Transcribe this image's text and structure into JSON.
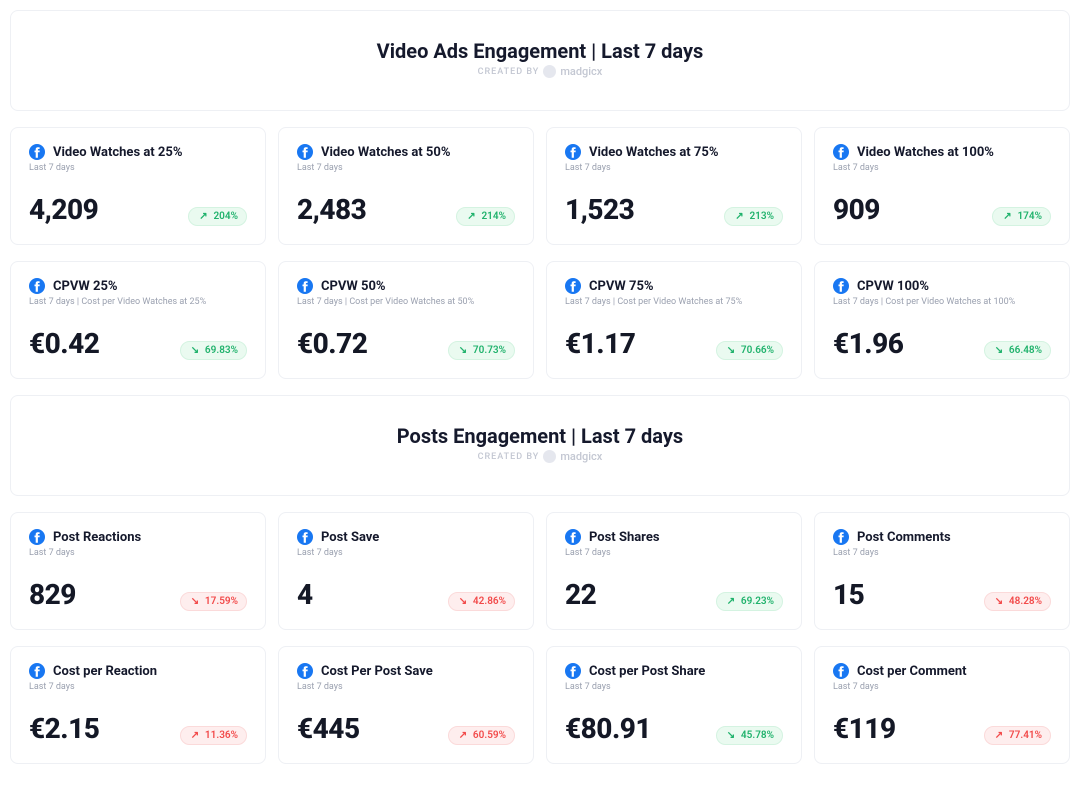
{
  "sections": [
    {
      "title": "Video Ads Engagement | Last 7 days",
      "created_by_label": "CREATED BY",
      "brand": "madgicx",
      "rows": [
        [
          {
            "icon": "facebook",
            "title": "Video Watches at 25%",
            "sub": "Last 7 days",
            "value": "4,209",
            "trend": {
              "dir": "up",
              "tone": "good",
              "text": "204%"
            }
          },
          {
            "icon": "facebook",
            "title": "Video Watches at 50%",
            "sub": "Last 7 days",
            "value": "2,483",
            "trend": {
              "dir": "up",
              "tone": "good",
              "text": "214%"
            }
          },
          {
            "icon": "facebook",
            "title": "Video Watches at 75%",
            "sub": "Last 7 days",
            "value": "1,523",
            "trend": {
              "dir": "up",
              "tone": "good",
              "text": "213%"
            }
          },
          {
            "icon": "facebook",
            "title": "Video Watches at 100%",
            "sub": "Last 7 days",
            "value": "909",
            "trend": {
              "dir": "up",
              "tone": "good",
              "text": "174%"
            }
          }
        ],
        [
          {
            "icon": "facebook",
            "title": "CPVW 25%",
            "sub": "Last 7 days | Cost per Video Watches at 25%",
            "value": "€0.42",
            "trend": {
              "dir": "down",
              "tone": "good",
              "text": "69.83%"
            }
          },
          {
            "icon": "facebook",
            "title": "CPVW 50%",
            "sub": "Last 7 days | Cost per Video Watches at 50%",
            "value": "€0.72",
            "trend": {
              "dir": "down",
              "tone": "good",
              "text": "70.73%"
            }
          },
          {
            "icon": "facebook",
            "title": "CPVW 75%",
            "sub": "Last 7 days | Cost per Video Watches at 75%",
            "value": "€1.17",
            "trend": {
              "dir": "down",
              "tone": "good",
              "text": "70.66%"
            }
          },
          {
            "icon": "facebook",
            "title": "CPVW 100%",
            "sub": "Last 7 days | Cost per Video Watches at 100%",
            "value": "€1.96",
            "trend": {
              "dir": "down",
              "tone": "good",
              "text": "66.48%"
            }
          }
        ]
      ]
    },
    {
      "title": "Posts Engagement | Last 7 days",
      "created_by_label": "CREATED BY",
      "brand": "madgicx",
      "rows": [
        [
          {
            "icon": "facebook",
            "title": "Post Reactions",
            "sub": "Last 7 days",
            "value": "829",
            "trend": {
              "dir": "down",
              "tone": "bad",
              "text": "17.59%"
            }
          },
          {
            "icon": "facebook",
            "title": "Post Save",
            "sub": "Last 7 days",
            "value": "4",
            "trend": {
              "dir": "down",
              "tone": "bad",
              "text": "42.86%"
            }
          },
          {
            "icon": "facebook",
            "title": "Post Shares",
            "sub": "Last 7 days",
            "value": "22",
            "trend": {
              "dir": "up",
              "tone": "good",
              "text": "69.23%"
            }
          },
          {
            "icon": "facebook",
            "title": "Post Comments",
            "sub": "Last 7 days",
            "value": "15",
            "trend": {
              "dir": "down",
              "tone": "bad",
              "text": "48.28%"
            }
          }
        ],
        [
          {
            "icon": "facebook",
            "title": "Cost per Reaction",
            "sub": "Last 7 days",
            "value": "€2.15",
            "trend": {
              "dir": "up",
              "tone": "bad",
              "text": "11.36%"
            }
          },
          {
            "icon": "facebook",
            "title": "Cost Per Post Save",
            "sub": "Last 7 days",
            "value": "€445",
            "trend": {
              "dir": "up",
              "tone": "bad",
              "text": "60.59%"
            }
          },
          {
            "icon": "facebook",
            "title": "Cost per Post Share",
            "sub": "Last 7 days",
            "value": "€80.91",
            "trend": {
              "dir": "down",
              "tone": "good",
              "text": "45.78%"
            }
          },
          {
            "icon": "facebook",
            "title": "Cost per Comment",
            "sub": "Last 7 days",
            "value": "€119",
            "trend": {
              "dir": "up",
              "tone": "bad",
              "text": "77.41%"
            }
          }
        ]
      ]
    }
  ],
  "icons": {
    "facebook_svg": "<svg viewBox='0 0 16 16' xmlns='http://www.w3.org/2000/svg'><circle cx='8' cy='8' r='8' fill='#1877F2'/><path d='M10.6 8.3h-1.7v5.4H6.7V8.3H5.5V6.5h1.2V5.4c0-1.3.6-2.2 2.3-2.2h1.6v1.8H9.7c-.5 0-.8.2-.8.7v.8h1.8l-.1 1.8z' fill='#fff'/></svg>"
  },
  "arrows": {
    "up": "↗",
    "down": "↘"
  },
  "colors": {
    "good_bg": "#eafaf0",
    "good_fg": "#20b26c",
    "bad_bg": "#feeeee",
    "bad_fg": "#f24a4a"
  }
}
